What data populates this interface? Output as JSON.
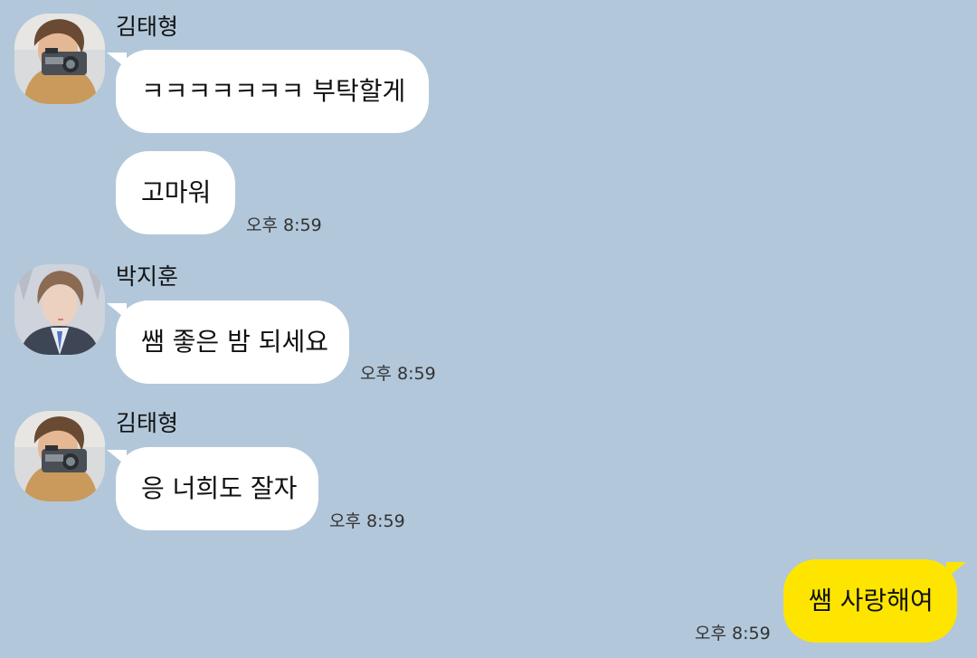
{
  "messages": [
    {
      "sender": "김태형",
      "text": "ㅋㅋㅋㅋㅋㅋㅋ 부탁할게"
    },
    {
      "text": "고마워",
      "time": "오후 8:59"
    },
    {
      "sender": "박지훈",
      "text": "쌤 좋은 밤 되세요",
      "time": "오후 8:59"
    },
    {
      "sender": "김태형",
      "text": "응 너희도 잘자",
      "time": "오후 8:59"
    },
    {
      "text": "쌤 사랑해여",
      "time": "오후 8:59"
    }
  ],
  "avatars": {
    "kim_taehyung": "avatar-photo-camera-selfie",
    "park_jihoon": "avatar-photo-portrait"
  },
  "colors": {
    "background": "#b2c7da",
    "incoming_bubble": "#ffffff",
    "outgoing_bubble": "#fee500",
    "text": "#111111",
    "timestamp": "#333333"
  }
}
